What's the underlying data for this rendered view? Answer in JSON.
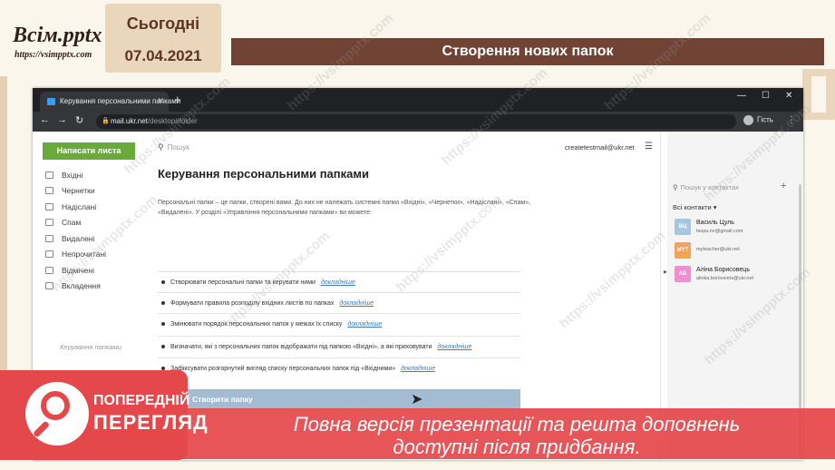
{
  "slide": {
    "logo_title": "Всім.pptx",
    "logo_url": "https://vsimpptx.com",
    "today_label": "Сьогодні",
    "date": "07.04.2021",
    "title": "Створення нових папок",
    "colors": {
      "title_bar": "#714335",
      "date_card": "#e9d6bb",
      "banner": "#e64246"
    }
  },
  "browser": {
    "tab_title": "Керування персональними папками",
    "address_host": "mail.ukr.net",
    "address_path": "/desktop#folder",
    "profile_label": "Гість",
    "icons": {
      "back": "back-arrow-icon",
      "forward": "forward-arrow-icon",
      "reload": "reload-icon",
      "lock": "lock-icon"
    }
  },
  "mail": {
    "compose_label": "Написати листа",
    "folders": [
      "Вхідні",
      "Чернетки",
      "Надіслані",
      "Спам",
      "Видалені",
      "Непрочитані",
      "Відмічені",
      "Вкладення"
    ],
    "manage_folders": "Керування папками",
    "search_placeholder": "Пошук",
    "user_email": "createtestmail@ukr.net",
    "heading": "Керування персональними папками",
    "intro": "Персональні папки – це папки, створені вами. До них не належать системні папки «Вхідні», «Чернетки», «Надіслані», «Спам», «Видалені». У розділі «Управління персональними папками» ви можете:",
    "features": [
      {
        "text": "Створювати персональні папки та керувати ними",
        "more": "докладніше"
      },
      {
        "text": "Формувати правила розподілу вхідних листів по папках",
        "more": "докладніше"
      },
      {
        "text": "Змінювати порядок персональних папок у межах їх списку",
        "more": "докладніше"
      },
      {
        "text": "Визначати, які з персональних папок відображати під папкою «Вхідні», а які приховувати",
        "more": "докладніше"
      },
      {
        "text": "Зафіксувати розгорнутий вигляд списку персональних папок під «Вхідними»",
        "more": "докладніше"
      }
    ],
    "create_button": "Створити папку"
  },
  "contacts": {
    "search_placeholder": "Пошук у контактах",
    "all_label": "Всі контакти ▾",
    "list": [
      {
        "initials": "ВЦ",
        "name": "Василь Цуль",
        "email": "tsupu.ivr@gmail.com",
        "color": "#a9c6e0"
      },
      {
        "initials": "MYT",
        "name": "",
        "email": "myteacher@ukr.net",
        "color": "#f0a35a"
      },
      {
        "initials": "АБ",
        "name": "Аліна Борисовець",
        "email": "alinka.borisovets@ukr.net",
        "color": "#ee8fd0"
      }
    ]
  },
  "watermark": "https://vsimpptx.com",
  "preview": {
    "title": "ПОПЕРЕДНІЙ",
    "subtitle": "ПЕРЕГЛЯД",
    "banner_line1": "Повна версія презентації та решта доповнень",
    "banner_line2": "доступні після придбання."
  }
}
